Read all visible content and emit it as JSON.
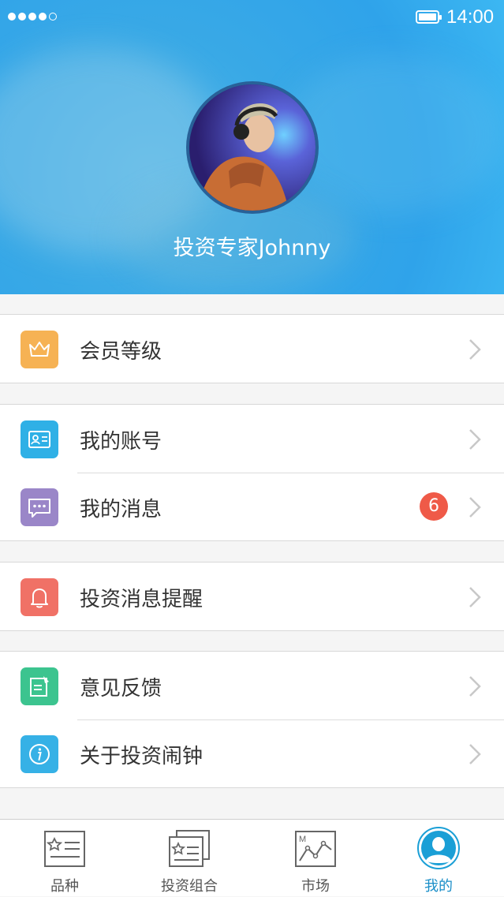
{
  "status_bar": {
    "time": "14:00"
  },
  "profile": {
    "username": "投资专家Johnny"
  },
  "menu_groups": [
    {
      "items": [
        {
          "label": "会员等级",
          "icon": "crown-icon",
          "icon_color": "#f6b254"
        }
      ]
    },
    {
      "items": [
        {
          "label": "我的账号",
          "icon": "id-card-icon",
          "icon_color": "#2fb0e6"
        },
        {
          "label": "我的消息",
          "icon": "message-icon",
          "icon_color": "#9a86c8",
          "badge": "6"
        }
      ]
    },
    {
      "items": [
        {
          "label": "投资消息提醒",
          "icon": "bell-icon",
          "icon_color": "#f07166"
        }
      ]
    },
    {
      "items": [
        {
          "label": "意见反馈",
          "icon": "feedback-icon",
          "icon_color": "#3cc48f"
        },
        {
          "label": "关于投资闹钟",
          "icon": "info-icon",
          "icon_color": "#36b1e6"
        }
      ]
    }
  ],
  "tab_bar": {
    "tabs": [
      {
        "label": "品种",
        "icon": "varieties-icon"
      },
      {
        "label": "投资组合",
        "icon": "portfolio-icon"
      },
      {
        "label": "市场",
        "icon": "market-chart-icon"
      },
      {
        "label": "我的",
        "icon": "user-profile-icon",
        "active": true
      }
    ]
  },
  "colors": {
    "accent": "#1a8ec8",
    "badge": "#ef5a48",
    "header": "#39a9e6"
  }
}
